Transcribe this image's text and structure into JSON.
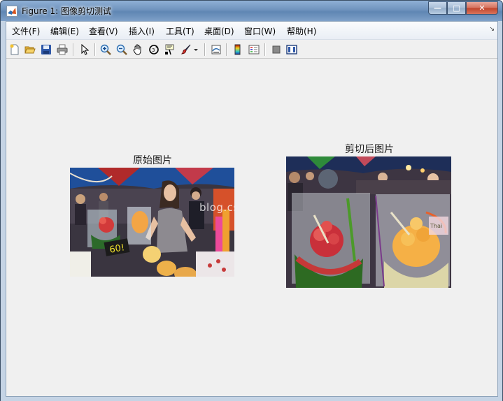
{
  "window": {
    "title": "Figure 1: 图像剪切测试",
    "minimize_glyph": "—",
    "maximize_glyph": "□",
    "close_glyph": "✕"
  },
  "menu": {
    "items": [
      "文件(F)",
      "编辑(E)",
      "查看(V)",
      "插入(I)",
      "工具(T)",
      "桌面(D)",
      "窗口(W)",
      "帮助(H)"
    ],
    "dock_arrow": "↘"
  },
  "toolbar": {
    "icons": [
      "new-figure-icon",
      "open-file-icon",
      "save-figure-icon",
      "print-figure-icon",
      "edit-plot-arrow-icon",
      "zoom-in-icon",
      "zoom-out-icon",
      "pan-hand-icon",
      "rotate-3d-icon",
      "data-cursor-icon",
      "brush-icon",
      "brush-dropdown-icon",
      "link-plot-icon",
      "insert-colorbar-icon",
      "insert-legend-icon",
      "hide-plot-tools-icon",
      "show-plot-tools-icon"
    ]
  },
  "figure": {
    "left_title": "原始图片",
    "right_title": "剪切后图片",
    "watermark": "blog.csdn.net/",
    "price_tag": "60!",
    "cup_label": "Thai"
  }
}
